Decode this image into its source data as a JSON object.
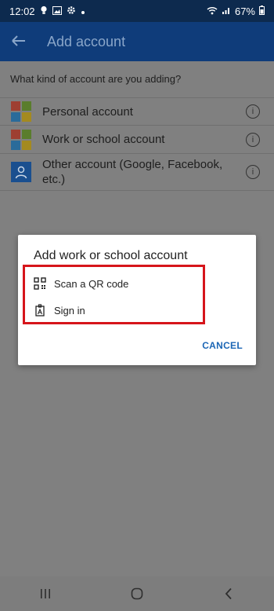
{
  "status_bar": {
    "time": "12:02",
    "battery": "67%",
    "icons": [
      "bulb-icon",
      "image-icon",
      "gear-icon",
      "dot-icon",
      "wifi-icon",
      "signal-icon",
      "battery-icon"
    ]
  },
  "app_bar": {
    "title": "Add account",
    "back_icon": "arrow-left-icon"
  },
  "main": {
    "question": "What kind of account are you adding?",
    "items": [
      {
        "label": "Personal account",
        "icon": "microsoft-logo-icon"
      },
      {
        "label": "Work or school account",
        "icon": "microsoft-logo-icon"
      },
      {
        "label": "Other account (Google, Facebook, etc.)",
        "icon": "user-icon"
      }
    ],
    "info_glyph": "i"
  },
  "dialog": {
    "title": "Add work or school account",
    "options": [
      {
        "label": "Scan a QR code",
        "icon": "qr-code-icon"
      },
      {
        "label": "Sign in",
        "icon": "badge-icon"
      }
    ],
    "cancel_label": "CANCEL"
  },
  "nav_bar": {
    "recents_icon": "recents-icon",
    "home_icon": "home-icon",
    "back_icon": "chevron-left-icon"
  },
  "colors": {
    "status_bar": "#0d2a4e",
    "app_bar": "#0f3c7a",
    "accent": "#1b66b5",
    "highlight": "#d6151b",
    "scrim": "#808080"
  }
}
